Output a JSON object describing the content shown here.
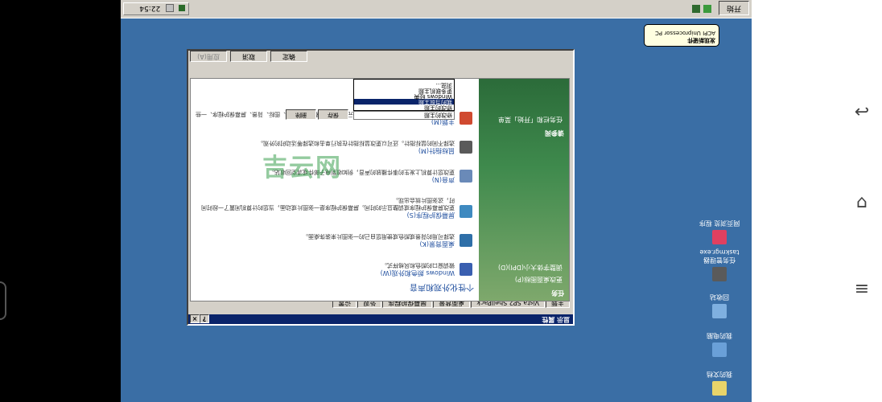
{
  "watermark": "吉云网",
  "taskbar": {
    "start_label": "开始",
    "clock": "22:54"
  },
  "balloon": {
    "title": "发现新硬件",
    "text": "ACPI Uniprocessor PC"
  },
  "desktop_icons": [
    {
      "label": "我的文档",
      "color": "#e8d46a"
    },
    {
      "label": "我的电脑",
      "color": "#6aa0d8"
    },
    {
      "label": "回收站",
      "color": "#7fb0e0"
    },
    {
      "label": "任务管理器 taskmgr.exe",
      "color": "#5a5a5a"
    },
    {
      "label": "网页浏览 程序",
      "color": "#e04060"
    }
  ],
  "dialog": {
    "title": "显示 属性",
    "tabs": [
      "主题",
      "Vista SP2 ShellPack",
      "桌面背景",
      "屏幕保护程序",
      "外观",
      "设置"
    ],
    "sidebar": {
      "section1": "任务",
      "links1": [
        "更改桌面图标(P)",
        "调整字体大小(DPI)(D)"
      ],
      "section2": "请参阅",
      "links2": [
        "任务栏和「开始」菜单"
      ]
    },
    "heading": "个性化外观和声音",
    "items": [
      {
        "link": "Windows 颜色和外观(W)",
        "desc": "微调窗口的颜色和风格样式。",
        "color": "#3a5fb0"
      },
      {
        "link": "桌面背景(K)",
        "desc": "选择可用的背景或颜色或使用您自己的一张图片来装饰桌面。",
        "color": "#2f6fa8"
      },
      {
        "link": "屏幕保护程序(S)",
        "desc": "更改屏幕保护程序或调整显示的时间。屏幕保护程序是一张图片或动画，当您的计算机闲置了一段时间时，这张图片就会出现。",
        "color": "#3f8ac0"
      },
      {
        "link": "声音(N)",
        "desc": "更改您计算机上发生的事件播放的声音，例如收到电子邮件或清空回收站。",
        "color": "#6a8ab8"
      },
      {
        "link": "鼠标指针(M)",
        "desc": "选择不同的鼠标指针。还可以更改鼠标指针在执行单击和选择等活动时的外观。",
        "color": "#5a5a5a"
      },
      {
        "link": "主题(M)",
        "desc": "更改主题。主题是一次可以更改许多视觉元素和听觉元素，包括菜单、图标、背景、屏幕保护程序、一些计算机声音以及鼠标指针的外观。",
        "color": "#d04a30"
      }
    ],
    "theme": {
      "selected": "修改的主题",
      "options": [
        "修改的主题",
        "我的当前主题",
        "Windows 经典",
        "更多联机主题",
        "浏览..."
      ],
      "save": "保存",
      "delete": "删除",
      "note": "显示区域。以便在桌面上的屏幕边缘出现，还可以选择高级缩略图"
    },
    "buttons": {
      "ok": "确定",
      "cancel": "取消",
      "apply": "应用(A)"
    }
  }
}
